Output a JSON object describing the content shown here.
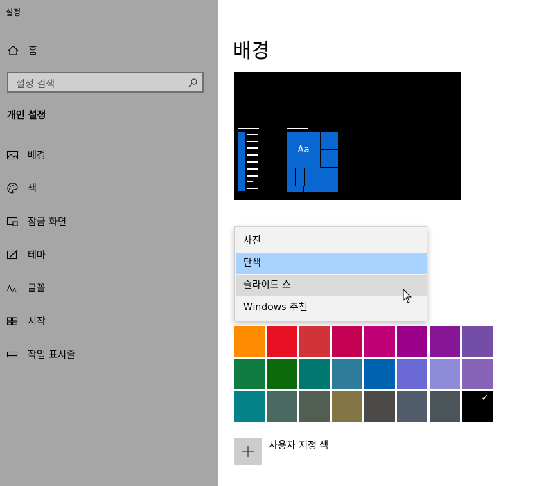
{
  "app": {
    "title": "설정"
  },
  "sidebar": {
    "home_label": "홈",
    "search_placeholder": "설정 검색",
    "section_title": "개인 설정",
    "items": [
      {
        "label": "배경",
        "icon": "picture-icon"
      },
      {
        "label": "색",
        "icon": "palette-icon"
      },
      {
        "label": "잠금 화면",
        "icon": "lock-screen-icon"
      },
      {
        "label": "테마",
        "icon": "theme-icon"
      },
      {
        "label": "글꼴",
        "icon": "font-icon"
      },
      {
        "label": "시작",
        "icon": "start-icon"
      },
      {
        "label": "작업 표시줄",
        "icon": "taskbar-icon"
      }
    ]
  },
  "main": {
    "title": "배경",
    "preview": {
      "tile_text": "Aa"
    },
    "dropdown": {
      "options": [
        "사진",
        "단색",
        "슬라이드 쇼",
        "Windows 추천"
      ],
      "selected": "단색",
      "hovered": "슬라이드 쇼"
    },
    "colors": [
      "#ff8c00",
      "#e81123",
      "#d13438",
      "#c30052",
      "#bf0077",
      "#9a0089",
      "#881798",
      "#744da9",
      "#107c41",
      "#0b6a0b",
      "#00786f",
      "#2d7d9a",
      "#0063b1",
      "#6b69d6",
      "#8e8cd8",
      "#8764b8",
      "#038387",
      "#486860",
      "#525e54",
      "#847545",
      "#4c4a48",
      "#515c6b",
      "#4a5459",
      "#000000"
    ],
    "selected_color_index": 23,
    "custom_color_label": "사용자 지정 색",
    "accent": "#0a66d1"
  }
}
